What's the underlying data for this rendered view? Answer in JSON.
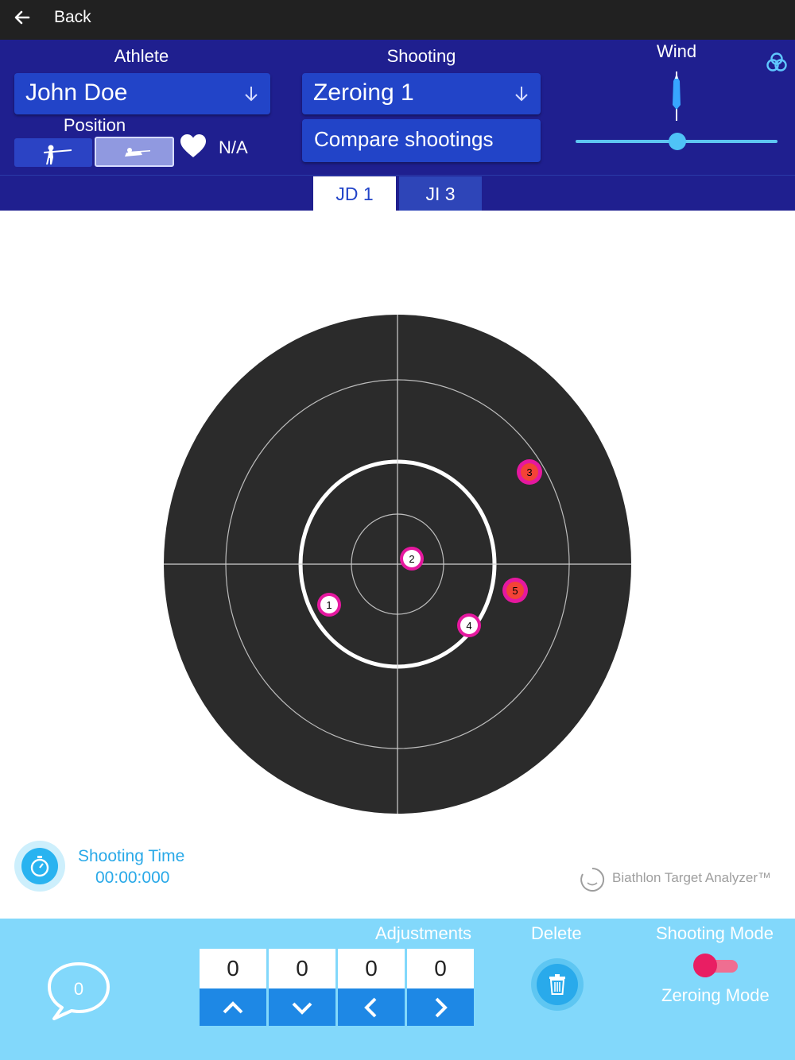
{
  "topbar": {
    "back_label": "Back"
  },
  "header": {
    "athlete_label": "Athlete",
    "athlete_value": "John Doe",
    "position_label": "Position",
    "heart_rate": "N/A",
    "shooting_label": "Shooting",
    "shooting_value": "Zeroing 1",
    "compare_label": "Compare shootings",
    "wind_label": "Wind",
    "wind_level": 0.5
  },
  "tabs": [
    {
      "label": "JD 1",
      "active": true
    },
    {
      "label": "JI 3",
      "active": false
    }
  ],
  "target": {
    "shots": [
      {
        "label": "1",
        "color": "#ffffff",
        "text_color": "#000000"
      },
      {
        "label": "2",
        "color": "#ffffff",
        "text_color": "#000000"
      },
      {
        "label": "3",
        "color": "#f44336",
        "text_color": "#000000"
      },
      {
        "label": "4",
        "color": "#ffffff",
        "text_color": "#000000"
      },
      {
        "label": "5",
        "color": "#f44336",
        "text_color": "#000000"
      }
    ]
  },
  "timer": {
    "label": "Shooting Time",
    "value": "00:00:000"
  },
  "brand": "Biathlon Target Analyzer™",
  "bottom": {
    "comment_count": "0",
    "adjustments_label": "Adjustments",
    "adjustments": [
      {
        "value": "0",
        "direction": "up"
      },
      {
        "value": "0",
        "direction": "down"
      },
      {
        "value": "0",
        "direction": "left"
      },
      {
        "value": "0",
        "direction": "right"
      }
    ],
    "delete_label": "Delete",
    "shooting_mode_label": "Shooting Mode",
    "zeroing_mode_label": "Zeroing Mode"
  },
  "colors": {
    "header_bg": "#1f1f8f",
    "accent_blue": "#2244c8",
    "light_blue": "#29a9e8",
    "bottom_bg": "#82d8fb",
    "shot_outline": "#e5189f",
    "toggle": "#e91e63"
  }
}
